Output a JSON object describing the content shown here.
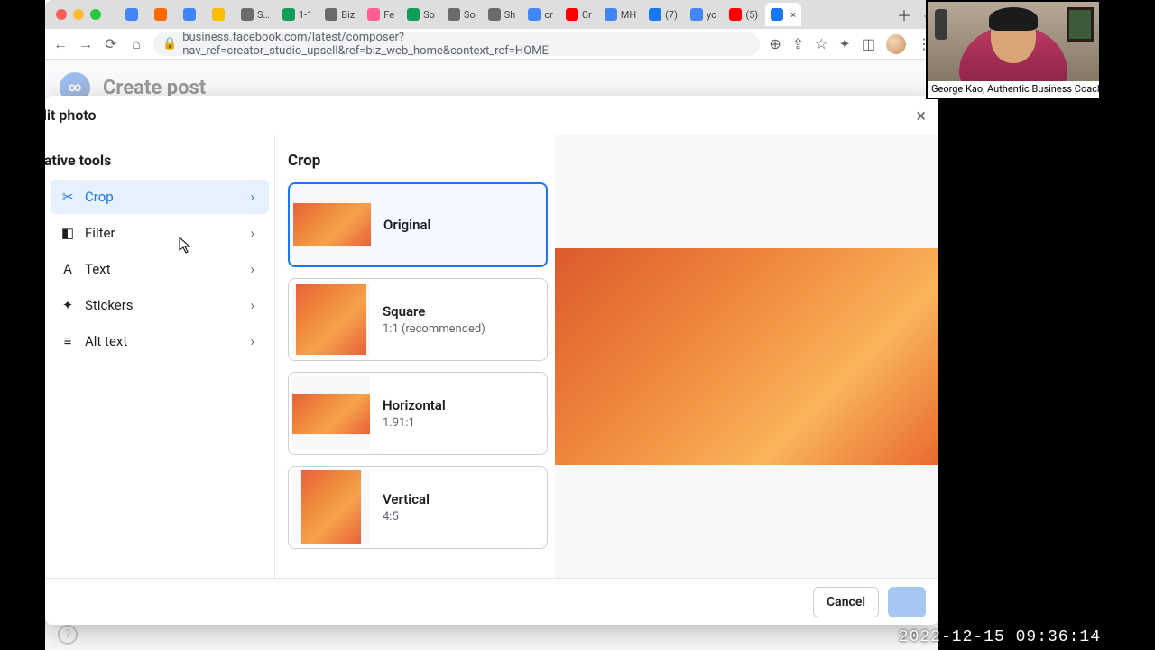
{
  "window": {
    "url": "business.facebook.com/latest/composer?nav_ref=creator_studio_upsell&ref=biz_web_home&context_ref=HOME",
    "tabs": [
      {
        "label": "",
        "fav": "#4285f4"
      },
      {
        "label": "",
        "fav": "#ff6a00"
      },
      {
        "label": "",
        "fav": "#4285f4"
      },
      {
        "label": "",
        "fav": "#fbbc05"
      },
      {
        "label": "S…",
        "fav": "#6b6b6b"
      },
      {
        "label": "1-1",
        "fav": "#0f9d58"
      },
      {
        "label": "Biz",
        "fav": "#6b6b6b"
      },
      {
        "label": "Fe",
        "fav": "#ff5e91"
      },
      {
        "label": "So",
        "fav": "#0f9d58"
      },
      {
        "label": "So",
        "fav": "#6b6b6b"
      },
      {
        "label": "Sh",
        "fav": "#6b6b6b"
      },
      {
        "label": "cr",
        "fav": "#4285f4"
      },
      {
        "label": "Cr",
        "fav": "#ff0000"
      },
      {
        "label": "MH",
        "fav": "#4285f4"
      },
      {
        "label": "(7)",
        "fav": "#1877f2"
      },
      {
        "label": "yo",
        "fav": "#4285f4"
      },
      {
        "label": "(5)",
        "fav": "#ff0000"
      },
      {
        "label": "",
        "fav": "#1877f2",
        "active": true
      }
    ]
  },
  "fb": {
    "page_title": "Create post",
    "logo_label": "∞"
  },
  "modal": {
    "title": "Edit photo",
    "close_label": "×",
    "sidebar_heading": "Creative tools",
    "tools": [
      {
        "key": "crop",
        "label": "Crop",
        "icon": "✂",
        "selected": true
      },
      {
        "key": "filter",
        "label": "Filter",
        "icon": "◧",
        "selected": false
      },
      {
        "key": "text",
        "label": "Text",
        "icon": "A",
        "selected": false
      },
      {
        "key": "stickers",
        "label": "Stickers",
        "icon": "✦",
        "selected": false
      },
      {
        "key": "alttext",
        "label": "Alt text",
        "icon": "≡",
        "selected": false
      }
    ],
    "crop": {
      "title": "Crop",
      "options": [
        {
          "key": "original",
          "name": "Original",
          "ratio": "",
          "thumb": "thumb-original",
          "selected": true
        },
        {
          "key": "square",
          "name": "Square",
          "ratio": "1:1 (recommended)",
          "thumb": "thumb-square",
          "selected": false
        },
        {
          "key": "horizontal",
          "name": "Horizontal",
          "ratio": "1.91:1",
          "thumb": "thumb-horizontal",
          "selected": false
        },
        {
          "key": "vertical",
          "name": "Vertical",
          "ratio": "4:5",
          "thumb": "thumb-vertical",
          "selected": false
        }
      ]
    },
    "footer": {
      "cancel": "Cancel",
      "save": ""
    }
  },
  "overlay": {
    "webcam_caption": "George Kao, Authentic Business Coach",
    "timestamp": "2022-12-15  09:36:14"
  }
}
